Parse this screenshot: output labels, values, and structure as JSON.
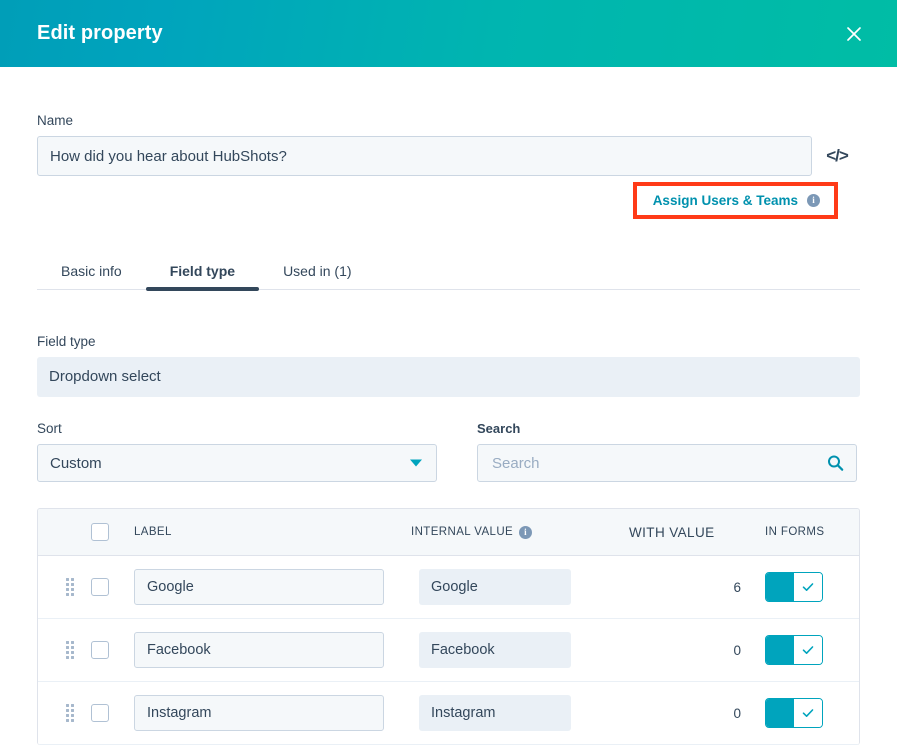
{
  "header": {
    "title": "Edit property",
    "close_icon": "close-icon",
    "gradient_start": "#00A4BD",
    "gradient_end": "#00BDA5"
  },
  "name_section": {
    "label": "Name",
    "value": "How did you hear about HubShots?",
    "placeholder": "Name",
    "code_icon": "</>",
    "assign_link": "Assign Users & Teams",
    "assign_info_icon": "i",
    "highlight_color": "#ff3a17"
  },
  "tabs": [
    {
      "label": "Basic info",
      "active": false
    },
    {
      "label": "Field type",
      "active": true
    },
    {
      "label": "Used in (1)",
      "active": false
    }
  ],
  "field_type": {
    "label": "Field type",
    "value": "Dropdown select"
  },
  "sort": {
    "label": "Sort",
    "value": "Custom"
  },
  "search": {
    "label": "Search",
    "value": "",
    "placeholder": "Search",
    "icon": "search-icon"
  },
  "options_table": {
    "columns": {
      "label": "LABEL",
      "internal_value": "INTERNAL VALUE",
      "internal_value_info_icon": "i",
      "with_value": "WITH VALUE",
      "in_forms": "IN FORMS"
    },
    "rows": [
      {
        "label": "Google",
        "internal_value": "Google",
        "with_value": "6",
        "in_forms": true
      },
      {
        "label": "Facebook",
        "internal_value": "Facebook",
        "with_value": "0",
        "in_forms": true
      },
      {
        "label": "Instagram",
        "internal_value": "Instagram",
        "with_value": "0",
        "in_forms": true
      }
    ]
  }
}
